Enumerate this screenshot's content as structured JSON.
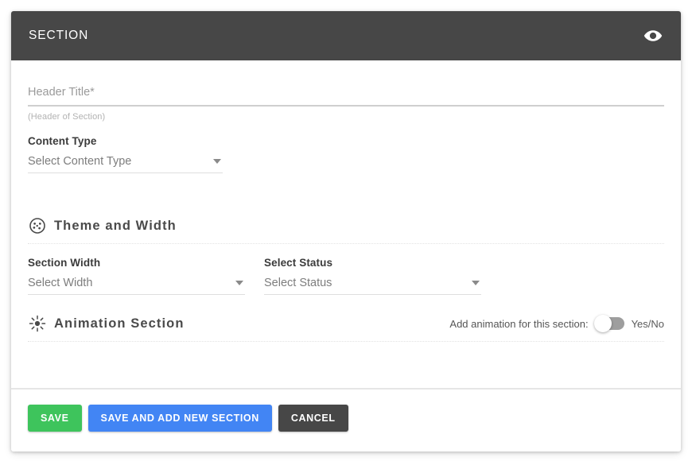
{
  "header": {
    "title": "SECTION",
    "preview_icon": "eye-icon"
  },
  "form": {
    "header_title": {
      "placeholder": "Header Title*",
      "value": "",
      "helper": "(Header of Section)"
    },
    "content_type": {
      "label": "Content Type",
      "selected": "Select Content Type"
    }
  },
  "theme_section": {
    "icon": "palette-icon",
    "title": "Theme and Width",
    "section_width": {
      "label": "Section Width",
      "selected": "Select Width"
    },
    "select_status": {
      "label": "Select Status",
      "selected": "Select Status"
    }
  },
  "animation_section": {
    "icon": "sparkle-icon",
    "title": "Animation Section",
    "toggle_label": "Add animation for this section:",
    "toggle_state": "off",
    "toggle_yesno": "Yes/No"
  },
  "footer": {
    "save_label": "SAVE",
    "save_add_label": "SAVE AND ADD NEW SECTION",
    "cancel_label": "CANCEL"
  },
  "colors": {
    "header_bg": "#474747",
    "save_green": "#3ec45c",
    "save_add_blue": "#4285f4",
    "cancel_dark": "#474747",
    "toggle_off": "#9e9e9e"
  }
}
